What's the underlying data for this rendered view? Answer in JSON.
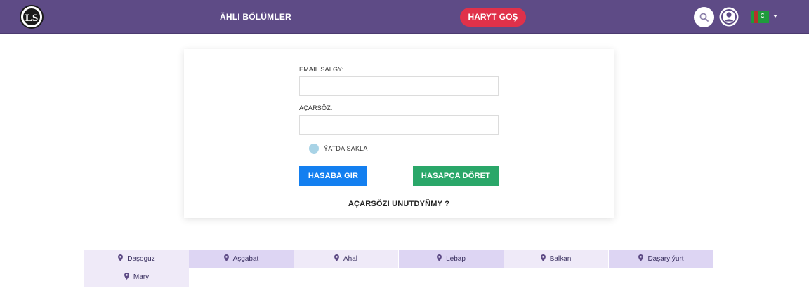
{
  "header": {
    "logo_text": "LS",
    "nav_all_label": "ÄHLI BÖLÜMLER",
    "shop_button_label": "HARYT GOŞ",
    "search_icon": "search-icon",
    "account_icon": "user-circle-icon",
    "language_flag": "turkmenistan-flag-icon"
  },
  "login_form": {
    "email_label": "EMAIL SALGY:",
    "email_value": "",
    "password_label": "AÇARSÖZ:",
    "password_value": "",
    "remember_label": "ÝATDA SAKLA",
    "login_button_label": "HASABA GIR",
    "register_button_label": "HASAPÇA DÖRET",
    "forgot_link_label": "AÇARSÖZI UNUTDYŇMY ?"
  },
  "regions": [
    {
      "label": "Daşoguz"
    },
    {
      "label": "Aşgabat"
    },
    {
      "label": "Ahal"
    },
    {
      "label": "Lebap"
    },
    {
      "label": "Balkan"
    },
    {
      "label": "Daşary ýurt"
    },
    {
      "label": "Mary"
    }
  ],
  "colors": {
    "header_bg": "#5e4b86",
    "shop_button": "#e0314a",
    "login_button": "#137ff0",
    "register_button": "#2aa769",
    "region_light": "#efeaf8",
    "region_dark": "#ddd5f3"
  }
}
